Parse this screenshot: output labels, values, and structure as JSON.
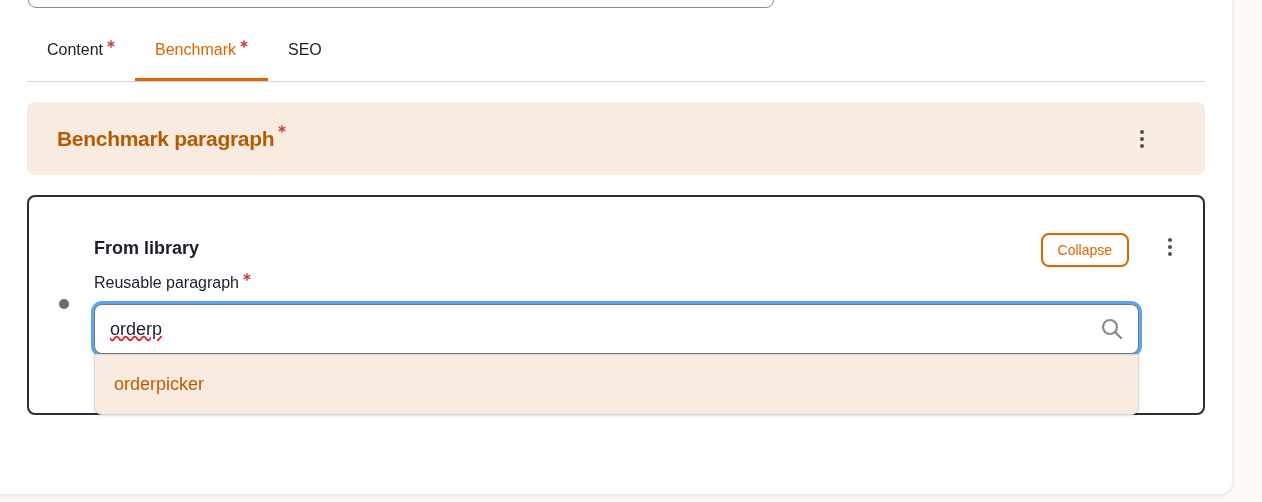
{
  "tabs": [
    {
      "label": "Content",
      "required": true,
      "selected": false
    },
    {
      "label": "Benchmark",
      "required": true,
      "selected": true
    },
    {
      "label": "SEO",
      "required": false,
      "selected": false
    }
  ],
  "section": {
    "title": "Benchmark paragraph",
    "required": true
  },
  "paragraph": {
    "title": "From library",
    "collapse_button": "Collapse",
    "field": {
      "label": "Reusable paragraph",
      "required": true,
      "value": "orderp",
      "focused": true
    },
    "suggestions": [
      {
        "label": "orderpicker",
        "selected": true
      }
    ]
  }
}
